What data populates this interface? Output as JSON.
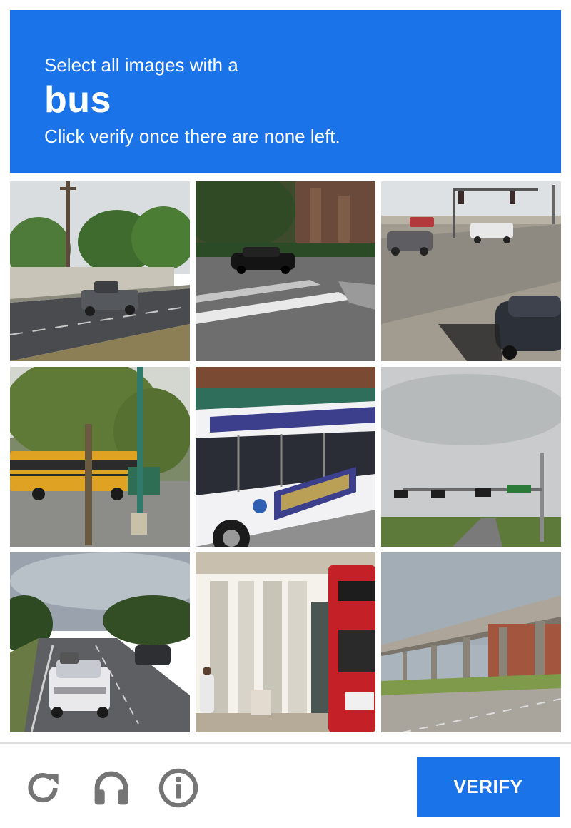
{
  "header": {
    "line1": "Select all images with a",
    "target": "bus",
    "line2": "Click verify once there are none left."
  },
  "grid": {
    "tiles": [
      {
        "scene": "highway with pickup truck and utility pole"
      },
      {
        "scene": "intersection with black sedan and crosswalk"
      },
      {
        "scene": "intersection with traffic lights and cars"
      },
      {
        "scene": "yellow school bus behind tree"
      },
      {
        "scene": "city transit bus close-up"
      },
      {
        "scene": "traffic signal over rural road"
      },
      {
        "scene": "suburban road with white SUV"
      },
      {
        "scene": "building facade with red double-decker bus"
      },
      {
        "scene": "elevated railway over highway"
      }
    ]
  },
  "footer": {
    "reload_icon": "reload-icon",
    "audio_icon": "headphones-icon",
    "info_icon": "info-icon",
    "verify_label": "VERIFY"
  },
  "colors": {
    "accent": "#1a73e8",
    "icon_gray": "#757575"
  }
}
